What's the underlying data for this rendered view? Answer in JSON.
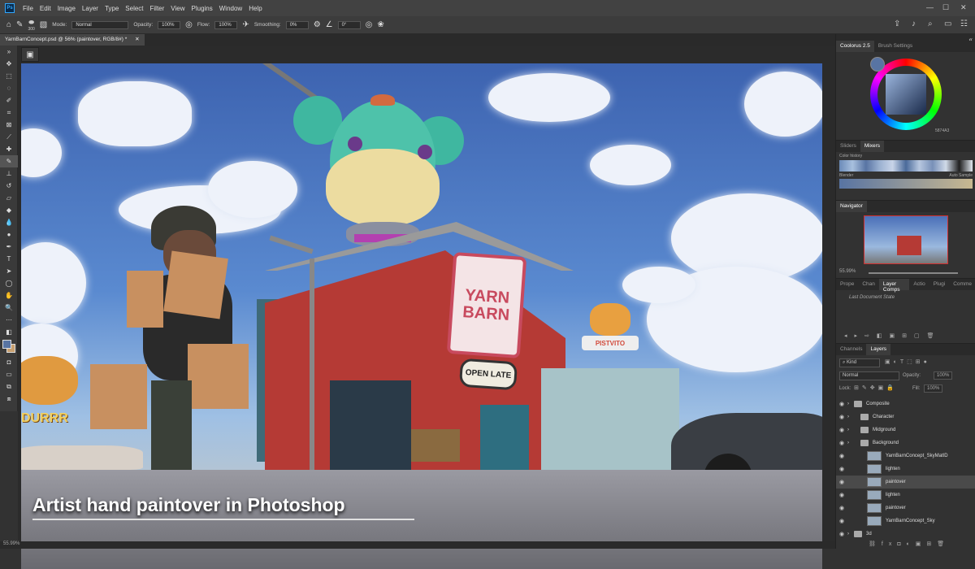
{
  "menubar": {
    "items": [
      "File",
      "Edit",
      "Image",
      "Layer",
      "Type",
      "Select",
      "Filter",
      "View",
      "Plugins",
      "Window",
      "Help"
    ]
  },
  "options": {
    "brush_size": "300",
    "mode_label": "Mode:",
    "mode_value": "Normal",
    "opacity_label": "Opacity:",
    "opacity_value": "100%",
    "flow_label": "Flow:",
    "flow_value": "100%",
    "smoothing_label": "Smoothing:",
    "smoothing_value": "0%",
    "angle_value": "0°"
  },
  "document": {
    "tab_title": "YarnBarnConcept.psd @ 56% (paintover, RGB/8#) *",
    "zoom": "55.99%"
  },
  "canvas": {
    "sign_line1": "YARN",
    "sign_line2": "BARN",
    "open_sign": "OPEN LATE",
    "restaurant_sign": "DURRR",
    "diner_sign": "PISTVITO",
    "caption": "Artist hand paintover in Photoshop"
  },
  "panels": {
    "coolorus_tab": "Coolorus 2.5",
    "brush_settings_tab": "Brush Settings",
    "hex_value": "5874A3",
    "sliders_tab": "Sliders",
    "mixers_tab": "Mixers",
    "color_history_label": "Color history",
    "blender_label": "Blender",
    "auto_sample_label": "Auto Sample",
    "navigator_tab": "Navigator",
    "nav_zoom": "55.99%",
    "properties_tab": "Prope",
    "channels_tab": "Chan",
    "layer_comps_tab": "Layer Comps",
    "actions_tab": "Actio",
    "plugins_tab": "Plugi",
    "comments_tab": "Comme",
    "last_doc_state": "Last Document State",
    "channels_tab2": "Channels",
    "layers_tab": "Layers",
    "kind_label": "Kind",
    "blend_mode": "Normal",
    "layers_opacity_label": "Opacity:",
    "layers_opacity": "100%",
    "lock_label": "Lock:",
    "fill_label": "Fill:",
    "fill_value": "100%"
  },
  "layers": [
    {
      "name": "Composite",
      "type": "group",
      "indent": 0
    },
    {
      "name": "Character",
      "type": "group",
      "indent": 1
    },
    {
      "name": "Midground",
      "type": "group",
      "indent": 1
    },
    {
      "name": "Background",
      "type": "group",
      "indent": 1
    },
    {
      "name": "YarnBarnConcept_SkyMatID",
      "type": "layer",
      "indent": 2
    },
    {
      "name": "lighten",
      "type": "layer",
      "indent": 2
    },
    {
      "name": "paintover",
      "type": "layer",
      "indent": 2,
      "selected": true
    },
    {
      "name": "lighten",
      "type": "layer",
      "indent": 2
    },
    {
      "name": "paintover",
      "type": "layer",
      "indent": 2
    },
    {
      "name": "YarnBarnConcept_Sky",
      "type": "layer",
      "indent": 2
    },
    {
      "name": "3d",
      "type": "group",
      "indent": 0
    }
  ],
  "colors": {
    "accent": "#31a8ff",
    "foreground": "#5874A3",
    "barn_red": "#b53a35",
    "sign_pink": "#c84a5e"
  }
}
